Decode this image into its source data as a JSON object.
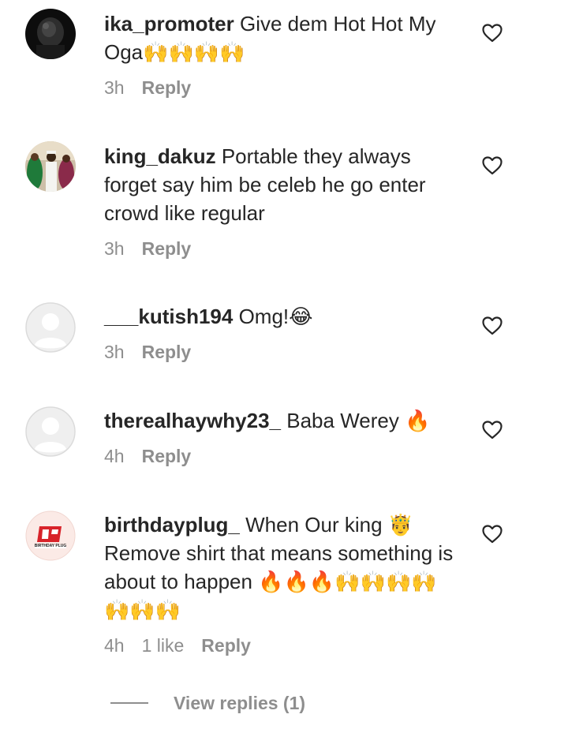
{
  "comments": [
    {
      "username": "ika_promoter",
      "text": "Give dem Hot Hot My Oga🙌🙌🙌🙌",
      "time": "3h",
      "likes": "",
      "reply_label": "Reply",
      "avatar": "dark-profile-photo"
    },
    {
      "username": "king_dakuz",
      "text": "Portable they always forget say him be celeb he go enter crowd like regular",
      "time": "3h",
      "likes": "",
      "reply_label": "Reply",
      "avatar": "event-photo"
    },
    {
      "username": "___kutish194",
      "text": "Omg!😂",
      "time": "3h",
      "likes": "",
      "reply_label": "Reply",
      "avatar": "default-avatar"
    },
    {
      "username": "therealhaywhy23_",
      "text": "Baba Werey 🔥",
      "time": "4h",
      "likes": "",
      "reply_label": "Reply",
      "avatar": "default-avatar"
    },
    {
      "username": "birthdayplug_",
      "text": "When Our king 🤴 Remove shirt that means something is about to happen 🔥🔥🔥🙌🙌🙌🙌🙌🙌🙌",
      "time": "4h",
      "likes": "1 like",
      "reply_label": "Reply",
      "avatar": "birthday-plug-logo",
      "avatar_logo_text": "BIRTHDAY PLUG"
    }
  ],
  "view_replies": {
    "label": "View replies (1)"
  },
  "colors": {
    "text": "#262626",
    "secondary": "#8e8e8e",
    "background": "#ffffff"
  }
}
